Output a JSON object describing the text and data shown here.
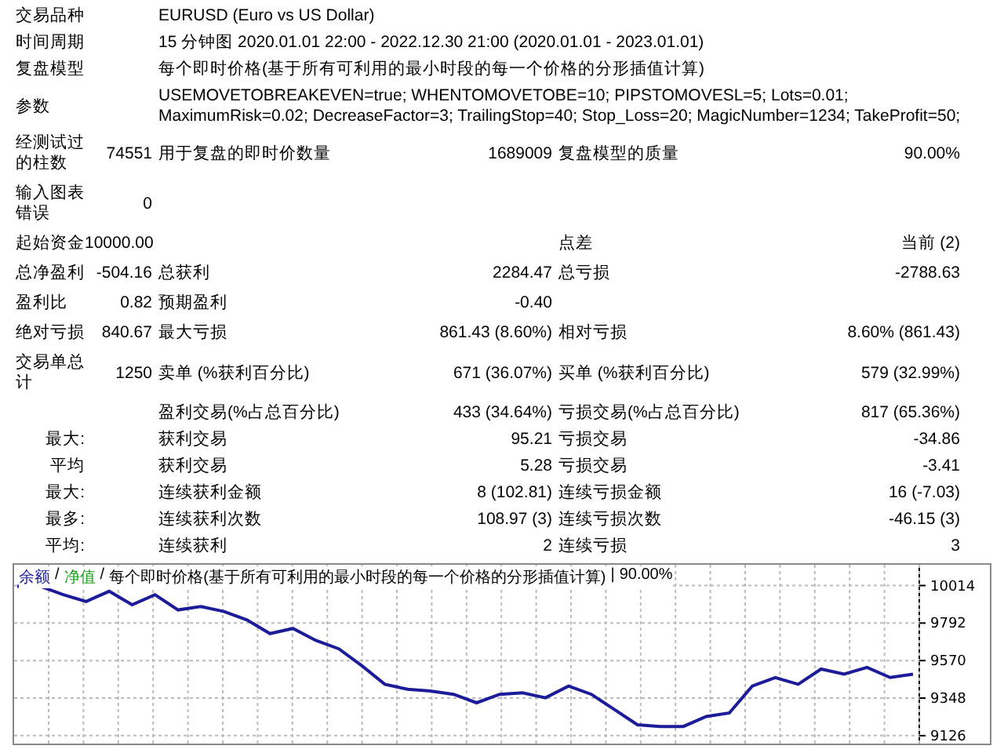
{
  "header": [
    {
      "label": "交易品种",
      "value": "EURUSD (Euro vs US Dollar)"
    },
    {
      "label": "时间周期",
      "value": "15 分钟图 2020.01.01 22:00 - 2022.12.30 21:00 (2020.01.01 - 2023.01.01)"
    },
    {
      "label": "复盘模型",
      "value": "每个即时价格(基于所有可利用的最小时段的每一个价格的分形插值计算)"
    },
    {
      "label": "参数",
      "value": "USEMOVETOBREAKEVEN=true; WHENTOMOVETOBE=10; PIPSTOMOVESL=5; Lots=0.01; MaximumRisk=0.02; DecreaseFactor=3; TrailingStop=40; Stop_Loss=20; MagicNumber=1234; TakeProfit=50;"
    }
  ],
  "stats": [
    {
      "kind": "main",
      "label_1": "经测试过的柱数",
      "value_1": "74551",
      "label_2": "用于复盘的即时价数量",
      "value_2": "1689009",
      "label_3": "复盘模型的质量",
      "value_3": "90.00%"
    },
    {
      "kind": "main",
      "label_1": "输入图表错误",
      "value_1": "0"
    },
    {
      "kind": "main",
      "label_1": "起始资金",
      "value_1": "10000.00",
      "label_3": "点差",
      "value_3": "当前 (2)"
    },
    {
      "kind": "main",
      "label_1": "总净盈利",
      "value_1": "-504.16",
      "label_2": "总获利",
      "value_2": "2284.47",
      "label_3": "总亏损",
      "value_3": "-2788.63"
    },
    {
      "kind": "main",
      "label_1": "盈利比",
      "value_1": "0.82",
      "label_2": "预期盈利",
      "value_2": "-0.40"
    },
    {
      "kind": "main",
      "label_1": "绝对亏损",
      "value_1": "840.67",
      "label_2": "最大亏损",
      "value_2": "861.43 (8.60%)",
      "label_3": "相对亏损",
      "value_3": "8.60% (861.43)"
    },
    {
      "kind": "main",
      "label_1": "交易单总计",
      "value_1": "1250",
      "label_2": "卖单 (%获利百分比)",
      "value_2": "671 (36.07%)",
      "label_3": "买单 (%获利百分比)",
      "value_3": "579 (32.99%)"
    },
    {
      "kind": "sub",
      "label_2": "盈利交易(%占总百分比)",
      "value_2": "433 (34.64%)",
      "label_3": "亏损交易(%占总百分比)",
      "value_3": "817 (65.36%)"
    },
    {
      "kind": "sub",
      "label_1": "最大:",
      "label_2": "获利交易",
      "value_2": "95.21",
      "label_3": "亏损交易",
      "value_3": "-34.86"
    },
    {
      "kind": "sub",
      "label_1": "平均",
      "label_2": "获利交易",
      "value_2": "5.28",
      "label_3": "亏损交易",
      "value_3": "-3.41"
    },
    {
      "kind": "sub",
      "label_1": "最大:",
      "label_2": "连续获利金额",
      "value_2": "8 (102.81)",
      "label_3": "连续亏损金额",
      "value_3": "16 (-7.03)"
    },
    {
      "kind": "sub",
      "label_1": "最多:",
      "label_2": "连续获利次数",
      "value_2": "108.97 (3)",
      "label_3": "连续亏损次数",
      "value_3": "-46.15 (3)"
    },
    {
      "kind": "sub",
      "label_1": "平均:",
      "label_2": "连续获利",
      "value_2": "2",
      "label_3": "连续亏损",
      "value_3": "3"
    }
  ],
  "chart": {
    "legend": [
      {
        "text": "/"
      },
      {
        "text": "净值",
        "color": "#20a020"
      },
      {
        "text": "/"
      },
      {
        "text": "每个即时价格(基于所有可利用的最小时段的每一个价格的分形插值计算)"
      },
      {
        "text": "|"
      },
      {
        "text": "90.00%"
      }
    ],
    "chart_data": {
      "type": "line",
      "grid": true,
      "ylim": [
        9079,
        10137
      ],
      "yticks": [
        10014,
        9792,
        9570,
        9348,
        9126
      ],
      "series": [
        {
          "name": "余额",
          "color": "#1c1c9a",
          "values": [
            10010,
            10010,
            9960,
            9920,
            9980,
            9900,
            9960,
            9870,
            9890,
            9860,
            9810,
            9730,
            9760,
            9690,
            9640,
            9540,
            9430,
            9400,
            9390,
            9370,
            9320,
            9370,
            9380,
            9350,
            9420,
            9370,
            9280,
            9190,
            9180,
            9180,
            9240,
            9260,
            9420,
            9470,
            9430,
            9520,
            9490,
            9530,
            9470,
            9490
          ]
        }
      ]
    }
  }
}
